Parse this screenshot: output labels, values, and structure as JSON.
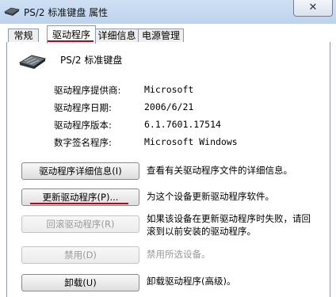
{
  "window": {
    "title": "PS/2 标准键盘 属性",
    "close_label": "✕"
  },
  "tabs": [
    {
      "label": "常规",
      "active": false
    },
    {
      "label": "驱动程序",
      "active": true
    },
    {
      "label": "详细信息",
      "active": false
    },
    {
      "label": "电源管理",
      "active": false
    }
  ],
  "device": {
    "name": "PS/2 标准键盘",
    "icon": "keyboard-icon"
  },
  "info": [
    {
      "label": "驱动程序提供商:",
      "value": "Microsoft"
    },
    {
      "label": "驱动程序日期:",
      "value": "2006/6/21"
    },
    {
      "label": "驱动程序版本:",
      "value": "6.1.7601.17514"
    },
    {
      "label": "数字签名程序:",
      "value": "Microsoft Windows"
    }
  ],
  "actions": [
    {
      "button": "驱动程序详细信息(I)",
      "description": "查看有关驱动程序文件的详细信息。",
      "enabled": true
    },
    {
      "button": "更新驱动程序(P)...",
      "description": "为这个设备更新驱动程序软件。",
      "enabled": true
    },
    {
      "button": "回滚驱动程序(R)",
      "description_line1": "如果该设备在更新驱动程序时失败，请回",
      "description_line2": "滚到以前安装的驱动程序。",
      "enabled": false
    },
    {
      "button": "禁用(D)",
      "description": "禁用所选设备。",
      "enabled": false
    },
    {
      "button": "卸载(U)",
      "description": "卸载驱动程序(高级)。",
      "enabled": true
    }
  ],
  "colors": {
    "highlight_underline": "#c00018",
    "titlebar": "#c4d8f0"
  }
}
